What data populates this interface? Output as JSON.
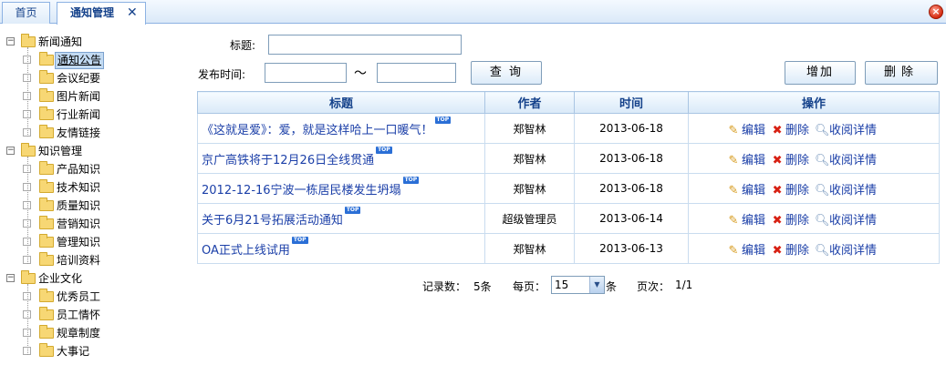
{
  "tabs": {
    "home_label": "首页",
    "active_label": "通知管理",
    "active_close": "✕",
    "window_close": "×"
  },
  "tree": [
    {
      "label": "新闻通知",
      "children": [
        "通知公告",
        "会议纪要",
        "图片新闻",
        "行业新闻",
        "友情链接"
      ],
      "selected": "通知公告"
    },
    {
      "label": "知识管理",
      "children": [
        "产品知识",
        "技术知识",
        "质量知识",
        "营销知识",
        "管理知识",
        "培训资料"
      ]
    },
    {
      "label": "企业文化",
      "children": [
        "优秀员工",
        "员工情怀",
        "规章制度",
        "大事记"
      ]
    }
  ],
  "search": {
    "title_label": "标题:",
    "title_value": "",
    "date_label": "发布时间:",
    "date_from": "",
    "date_sep": "～",
    "date_to": "",
    "query_button": "查 询"
  },
  "toolbar": {
    "add_button": "增加",
    "delete_button": "删除"
  },
  "table": {
    "columns": [
      "标题",
      "作者",
      "时间",
      "操作"
    ],
    "badge": "TOP",
    "actions": {
      "edit": "编辑",
      "delete": "删除",
      "detail": "收阅详情"
    },
    "rows": [
      {
        "title": "《这就是爱》：爱，就是这样哈上一口暖气！",
        "author": "郑智林",
        "date": "2013-06-18"
      },
      {
        "title": "京广高铁将于12月26日全线贯通",
        "author": "郑智林",
        "date": "2013-06-18"
      },
      {
        "title": "2012-12-16宁波一栋居民楼发生坍塌",
        "author": "郑智林",
        "date": "2013-06-18"
      },
      {
        "title": "关于6月21号拓展活动通知",
        "author": "超级管理员",
        "date": "2013-06-14"
      },
      {
        "title": "OA正式上线试用",
        "author": "郑智林",
        "date": "2013-06-13"
      }
    ]
  },
  "pager": {
    "records_label": "记录数：",
    "records_value": "5条",
    "per_page_label": "每页：",
    "per_page_value": "15",
    "per_page_unit": "条",
    "page_label": "页次：",
    "page_value": "1/1"
  }
}
